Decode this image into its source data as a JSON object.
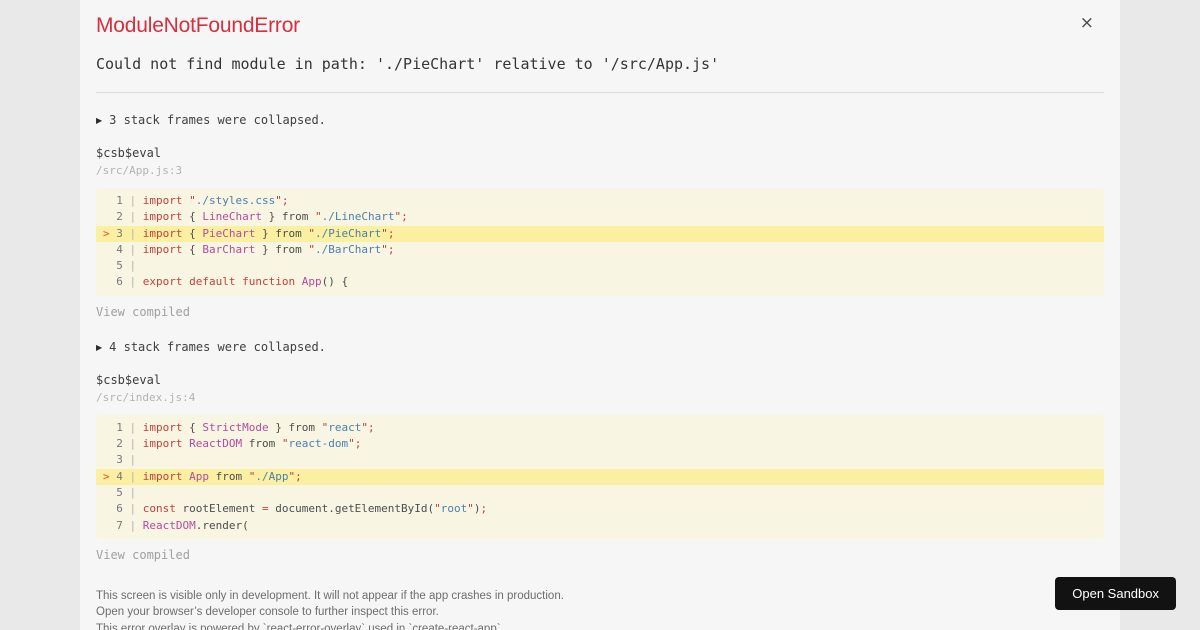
{
  "overlay": {
    "title": "ModuleNotFoundError",
    "close_label": "×",
    "message": "Could not find module in path: './PieChart' relative to '/src/App.js'"
  },
  "frames": [
    {
      "collapsed_icon": "▶",
      "collapsed": "3 stack frames were collapsed.",
      "fn": "$csb$eval",
      "location": "/src/App.js:3",
      "highlight_line": 3,
      "view_compiled": "View compiled",
      "code": [
        [
          [
            "k",
            "import"
          ],
          [
            "p",
            " "
          ],
          [
            "q",
            "\""
          ],
          [
            "s",
            "./styles.css"
          ],
          [
            "q",
            "\""
          ],
          [
            "k",
            ";"
          ]
        ],
        [
          [
            "k",
            "import"
          ],
          [
            "p",
            " { "
          ],
          [
            "i",
            "LineChart"
          ],
          [
            "p",
            " } from "
          ],
          [
            "q",
            "\""
          ],
          [
            "s",
            "./LineChart"
          ],
          [
            "q",
            "\""
          ],
          [
            "k",
            ";"
          ]
        ],
        [
          [
            "k",
            "import"
          ],
          [
            "p",
            " { "
          ],
          [
            "i",
            "PieChart"
          ],
          [
            "p",
            " } from "
          ],
          [
            "q",
            "\""
          ],
          [
            "s",
            "./PieChart"
          ],
          [
            "q",
            "\""
          ],
          [
            "k",
            ";"
          ]
        ],
        [
          [
            "k",
            "import"
          ],
          [
            "p",
            " { "
          ],
          [
            "i",
            "BarChart"
          ],
          [
            "p",
            " } from "
          ],
          [
            "q",
            "\""
          ],
          [
            "s",
            "./BarChart"
          ],
          [
            "q",
            "\""
          ],
          [
            "k",
            ";"
          ]
        ],
        [],
        [
          [
            "k",
            "export"
          ],
          [
            "p",
            " "
          ],
          [
            "k",
            "default"
          ],
          [
            "p",
            " "
          ],
          [
            "k",
            "function"
          ],
          [
            "p",
            " "
          ],
          [
            "i",
            "App"
          ],
          [
            "p",
            "() {"
          ]
        ]
      ]
    },
    {
      "collapsed_icon": "▶",
      "collapsed": "4 stack frames were collapsed.",
      "fn": "$csb$eval",
      "location": "/src/index.js:4",
      "highlight_line": 4,
      "view_compiled": "View compiled",
      "code": [
        [
          [
            "k",
            "import"
          ],
          [
            "p",
            " { "
          ],
          [
            "i",
            "StrictMode"
          ],
          [
            "p",
            " } from "
          ],
          [
            "q",
            "\""
          ],
          [
            "s",
            "react"
          ],
          [
            "q",
            "\""
          ],
          [
            "k",
            ";"
          ]
        ],
        [
          [
            "k",
            "import"
          ],
          [
            "p",
            " "
          ],
          [
            "i",
            "ReactDOM"
          ],
          [
            "p",
            " from "
          ],
          [
            "q",
            "\""
          ],
          [
            "s",
            "react-dom"
          ],
          [
            "q",
            "\""
          ],
          [
            "k",
            ";"
          ]
        ],
        [],
        [
          [
            "k",
            "import"
          ],
          [
            "p",
            " "
          ],
          [
            "i",
            "App"
          ],
          [
            "p",
            " from "
          ],
          [
            "q",
            "\""
          ],
          [
            "s",
            "./App"
          ],
          [
            "q",
            "\""
          ],
          [
            "k",
            ";"
          ]
        ],
        [],
        [
          [
            "k",
            "const"
          ],
          [
            "p",
            " rootElement "
          ],
          [
            "k",
            "="
          ],
          [
            "p",
            " document.getElementById("
          ],
          [
            "q",
            "\""
          ],
          [
            "s",
            "root"
          ],
          [
            "q",
            "\""
          ],
          [
            "p",
            ")"
          ],
          [
            "k",
            ";"
          ]
        ],
        [
          [
            "i",
            "ReactDOM"
          ],
          [
            "p",
            ".render("
          ]
        ]
      ]
    }
  ],
  "footer": {
    "lines": [
      "This screen is visible only in development. It will not appear if the app crashes in production.",
      "Open your browser’s developer console to further inspect this error.",
      "This error overlay is powered by `react-error-overlay` used in `create-react-app`."
    ],
    "open_sandbox": "Open Sandbox"
  },
  "colors": {
    "page_bg": "#e9e9e9",
    "overlay_bg": "#f6f6f6",
    "title_red": "#d5303e",
    "text_dark": "#353535",
    "muted": "#b3b3b3",
    "faint": "#a0a0a0",
    "footer_text": "#6d6d6d",
    "divider": "#dcdcdc",
    "code_bg": "#f8f5e3",
    "code_hl_bg": "#fbf0a1",
    "keyword": "#c5403a",
    "identifier": "#b44b9f",
    "string": "#4a7fae",
    "quote": "#a8423a",
    "plain": "#4d4d4d",
    "lineno": "#787878",
    "pipe": "#b4b4b4",
    "marker": "#e05038",
    "button_bg": "#121212",
    "button_text": "#ffffff"
  }
}
